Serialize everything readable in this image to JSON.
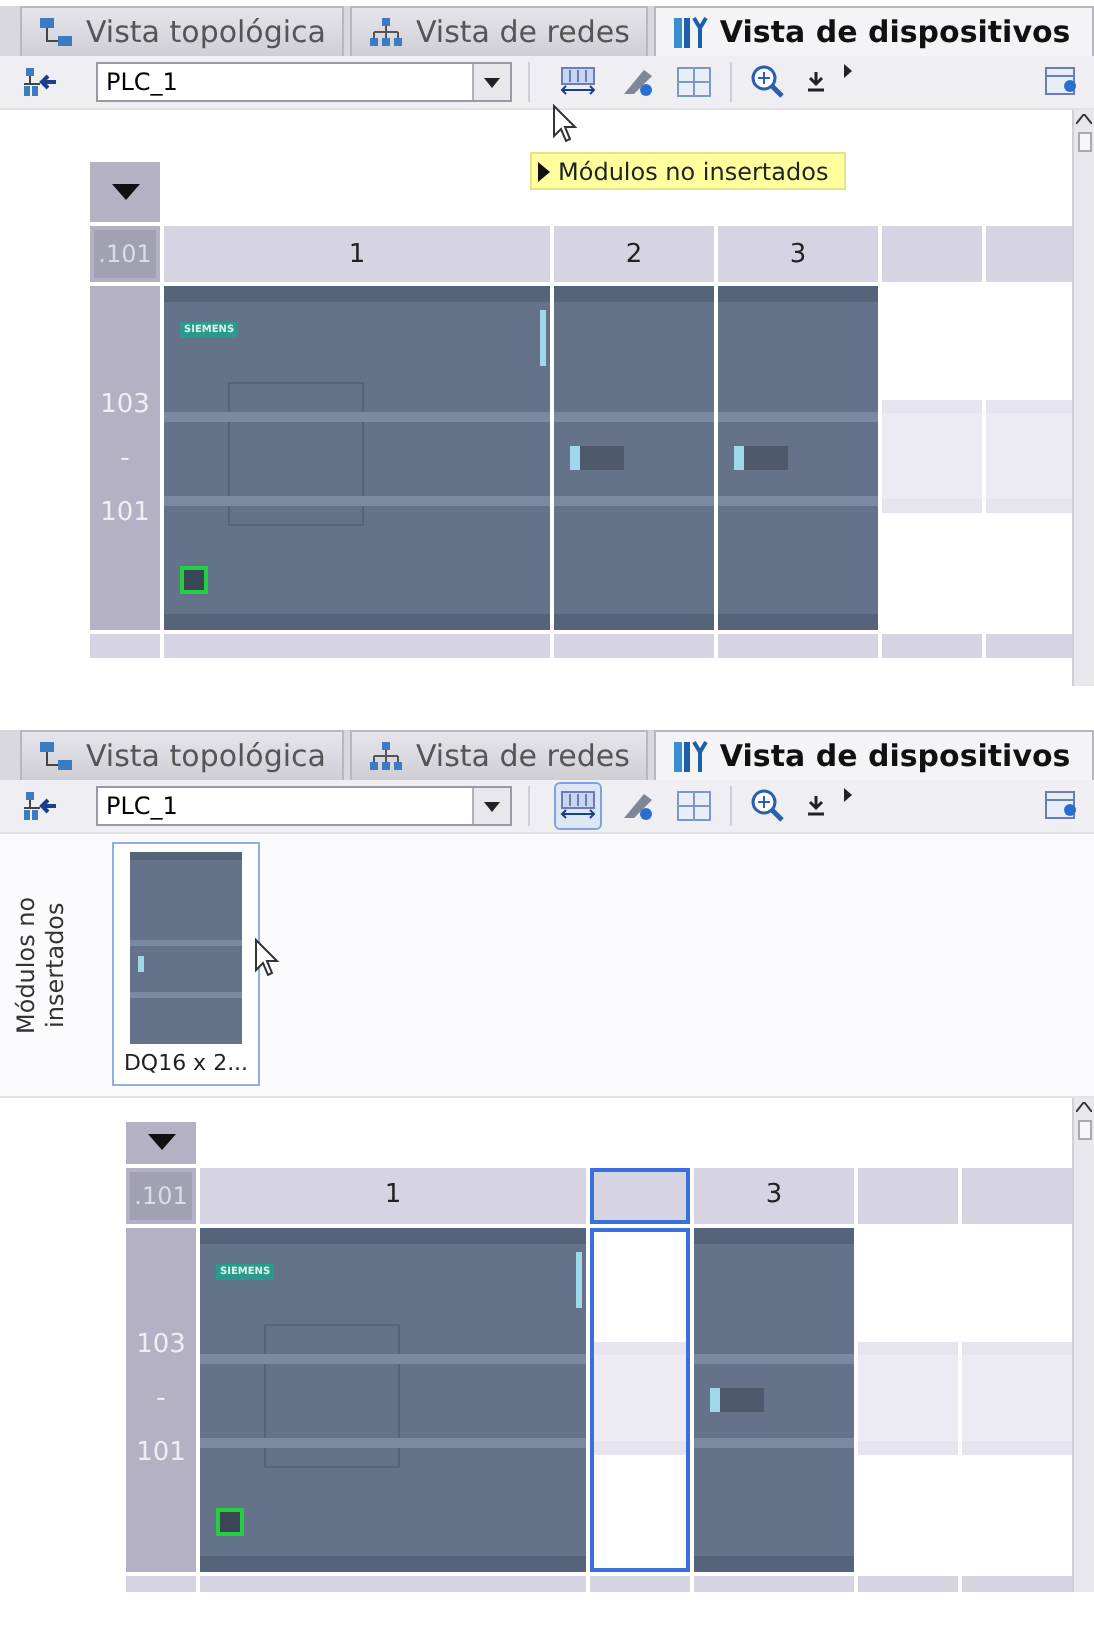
{
  "panels": [
    {
      "tabs": [
        {
          "label": "Vista topológica",
          "selected": false
        },
        {
          "label": "Vista de redes",
          "selected": false
        },
        {
          "label": "Vista de dispositivos",
          "selected": true
        }
      ],
      "toolbar": {
        "device": "PLC_1",
        "unplugged_pressed": false
      },
      "tooltip": "Módulos no insertados",
      "row_header": {
        "top": ".101",
        "labels": [
          "103",
          "-",
          "101"
        ]
      },
      "slots": [
        {
          "label": "1",
          "selected": false,
          "module": {
            "kind": "cpu",
            "badge": "SIEMENS"
          }
        },
        {
          "label": "2",
          "selected": false,
          "module": {
            "kind": "signal"
          }
        },
        {
          "label": "3",
          "selected": false,
          "module": {
            "kind": "signal"
          }
        },
        {
          "selected": false
        },
        {
          "selected": false
        }
      ]
    },
    {
      "tabs": [
        {
          "label": "Vista topológica",
          "selected": false
        },
        {
          "label": "Vista de redes",
          "selected": false
        },
        {
          "label": "Vista de dispositivos",
          "selected": true
        }
      ],
      "toolbar": {
        "device": "PLC_1",
        "unplugged_pressed": true
      },
      "unplugged_area": {
        "title": "Módulos no insertados",
        "modules": [
          {
            "caption": "DQ16 x 2...",
            "selected": true
          }
        ]
      },
      "row_header": {
        "top": ".101",
        "labels": [
          "103",
          "-",
          "101"
        ]
      },
      "slots": [
        {
          "label": "1",
          "selected": false,
          "module": {
            "kind": "cpu",
            "badge": "SIEMENS"
          }
        },
        {
          "selected": true
        },
        {
          "label": "3",
          "selected": false,
          "module": {
            "kind": "signal"
          }
        },
        {
          "selected": false
        },
        {
          "selected": false
        }
      ]
    }
  ]
}
